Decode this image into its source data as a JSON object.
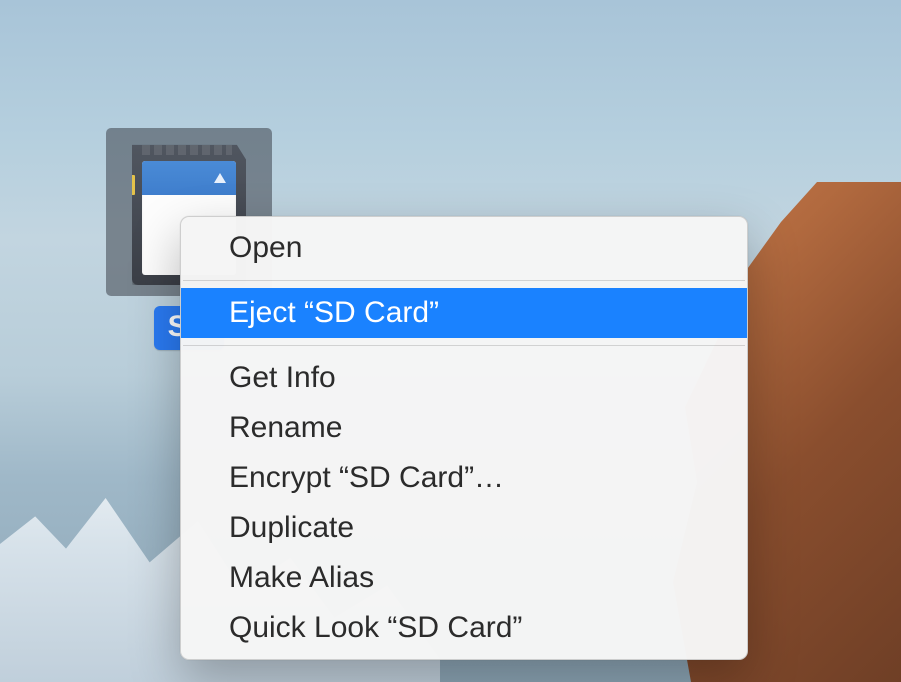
{
  "desktop": {
    "icon_label": "SD",
    "volume_name": "SD Card"
  },
  "context_menu": {
    "items": [
      {
        "label": "Open",
        "highlighted": false
      },
      {
        "separator": true
      },
      {
        "label": "Eject “SD Card”",
        "highlighted": true
      },
      {
        "separator": true
      },
      {
        "label": "Get Info",
        "highlighted": false
      },
      {
        "label": "Rename",
        "highlighted": false
      },
      {
        "label": "Encrypt “SD Card”…",
        "highlighted": false
      },
      {
        "label": "Duplicate",
        "highlighted": false
      },
      {
        "label": "Make Alias",
        "highlighted": false
      },
      {
        "label": "Quick Look “SD Card”",
        "highlighted": false
      }
    ]
  }
}
